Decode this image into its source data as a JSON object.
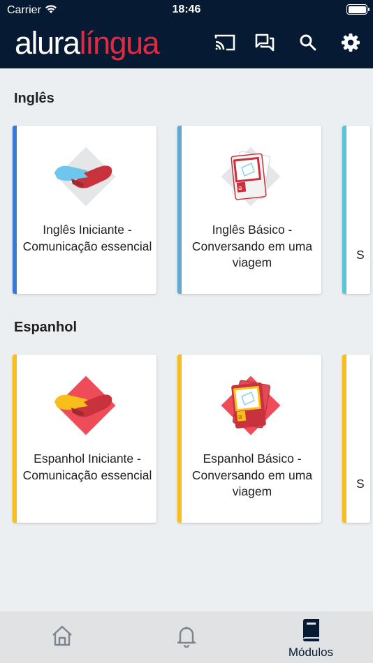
{
  "status": {
    "carrier": "Carrier",
    "time": "18:46"
  },
  "app": {
    "logo_part1": "alura",
    "logo_part2": "língua"
  },
  "header_icons": [
    "cast-icon",
    "forum-icon",
    "search-icon",
    "gear-icon"
  ],
  "colors": {
    "header_bg": "#061a33",
    "brand_red": "#e02a42",
    "ingles_stripe_1": "#3a78d8",
    "ingles_stripe_2": "#62a8d1",
    "ingles_stripe_3": "#58c4d4",
    "espanhol_stripe": "#f8bf1a"
  },
  "sections": [
    {
      "title": "Inglês",
      "cards": [
        {
          "title": "Inglês Iniciante - Comunicação essencial",
          "icon": "handshake-icon"
        },
        {
          "title": "Inglês Básico - Conversando em uma viagem",
          "icon": "tickets-icon"
        },
        {
          "title": "S",
          "icon": ""
        }
      ]
    },
    {
      "title": "Espanhol",
      "cards": [
        {
          "title": "Espanhol Iniciante - Comunicação essencial",
          "icon": "handshake-icon"
        },
        {
          "title": "Espanhol Básico - Conversando em uma viagem",
          "icon": "tickets-icon"
        },
        {
          "title": "S",
          "icon": ""
        }
      ]
    }
  ],
  "bottom_nav": {
    "items": [
      {
        "icon": "home-icon",
        "label": ""
      },
      {
        "icon": "bell-icon",
        "label": ""
      },
      {
        "icon": "book-icon",
        "label": "Módulos"
      }
    ]
  }
}
